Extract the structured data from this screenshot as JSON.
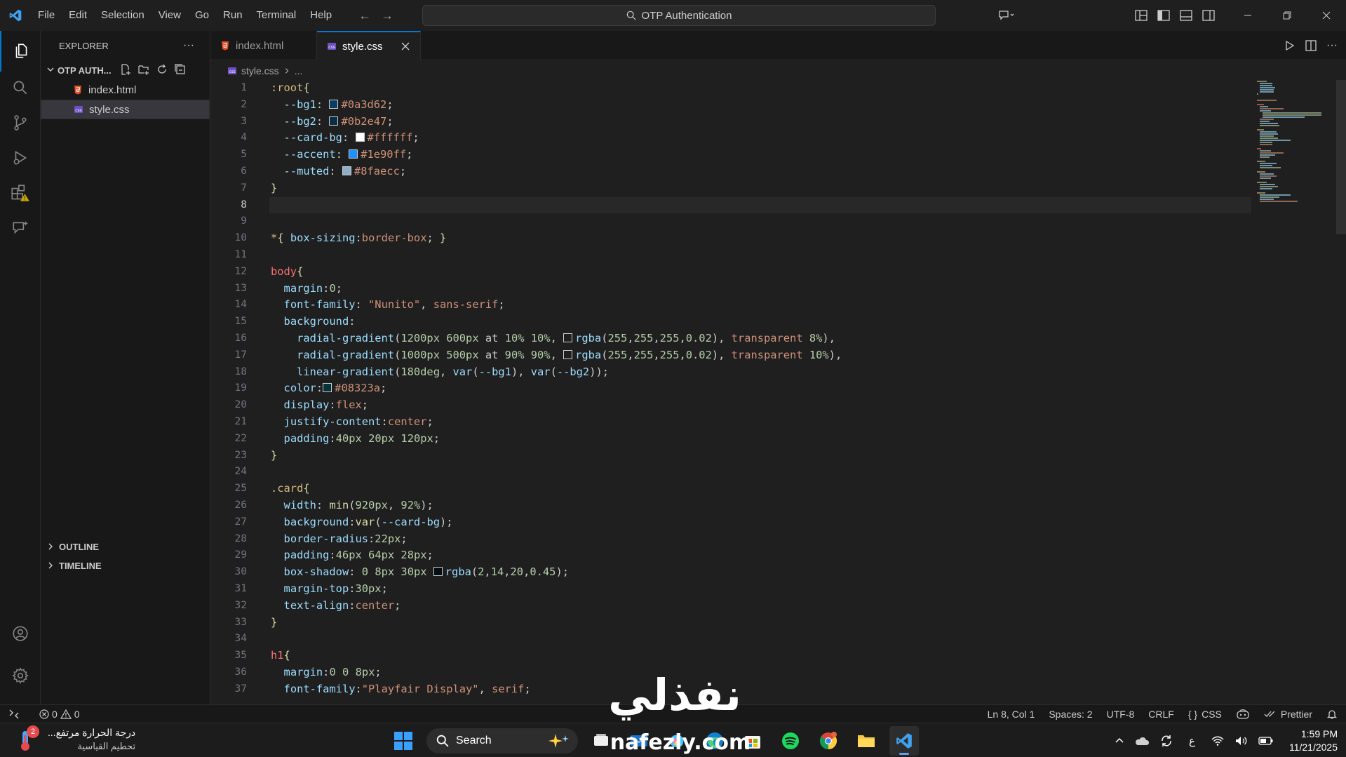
{
  "titlebar": {
    "menu": [
      "File",
      "Edit",
      "Selection",
      "View",
      "Go",
      "Run",
      "Terminal",
      "Help"
    ],
    "search_text": "OTP Authentication"
  },
  "sidebar": {
    "title": "EXPLORER",
    "more": "···",
    "folder": "OTP AUTH...",
    "files": [
      "index.html",
      "style.css"
    ],
    "outline": "OUTLINE",
    "timeline": "TIMELINE"
  },
  "tabs": [
    {
      "label": "index.html"
    },
    {
      "label": "style.css"
    }
  ],
  "breadcrumb": {
    "file": "style.css",
    "rest": "..."
  },
  "editor": {
    "current_line": 8,
    "line_count": 37
  },
  "status": {
    "errors": "0",
    "warnings": "0",
    "position": "Ln 8, Col 1",
    "spaces": "Spaces: 2",
    "encoding": "UTF-8",
    "eol": "CRLF",
    "language": "CSS",
    "prettier": "Prettier"
  },
  "taskbar": {
    "weather_title": "درجة الحرارة مرتفع...",
    "weather_sub": "تحطيم القياسية",
    "weather_badge": "2",
    "search": "Search",
    "lang": "ع",
    "time": "1:59 PM",
    "date": "11/21/2025"
  },
  "colors": {
    "accent": "#0078d4",
    "bg1": "#0a3d62",
    "bg2": "#0b2e47",
    "card_bg": "#ffffff",
    "css_accent": "#1e90ff",
    "muted": "#8faecc",
    "text": "#08323a",
    "shadow": "#020e14"
  },
  "watermark": {
    "arabic": "نفذلي",
    "latin": "nafezly.com"
  }
}
